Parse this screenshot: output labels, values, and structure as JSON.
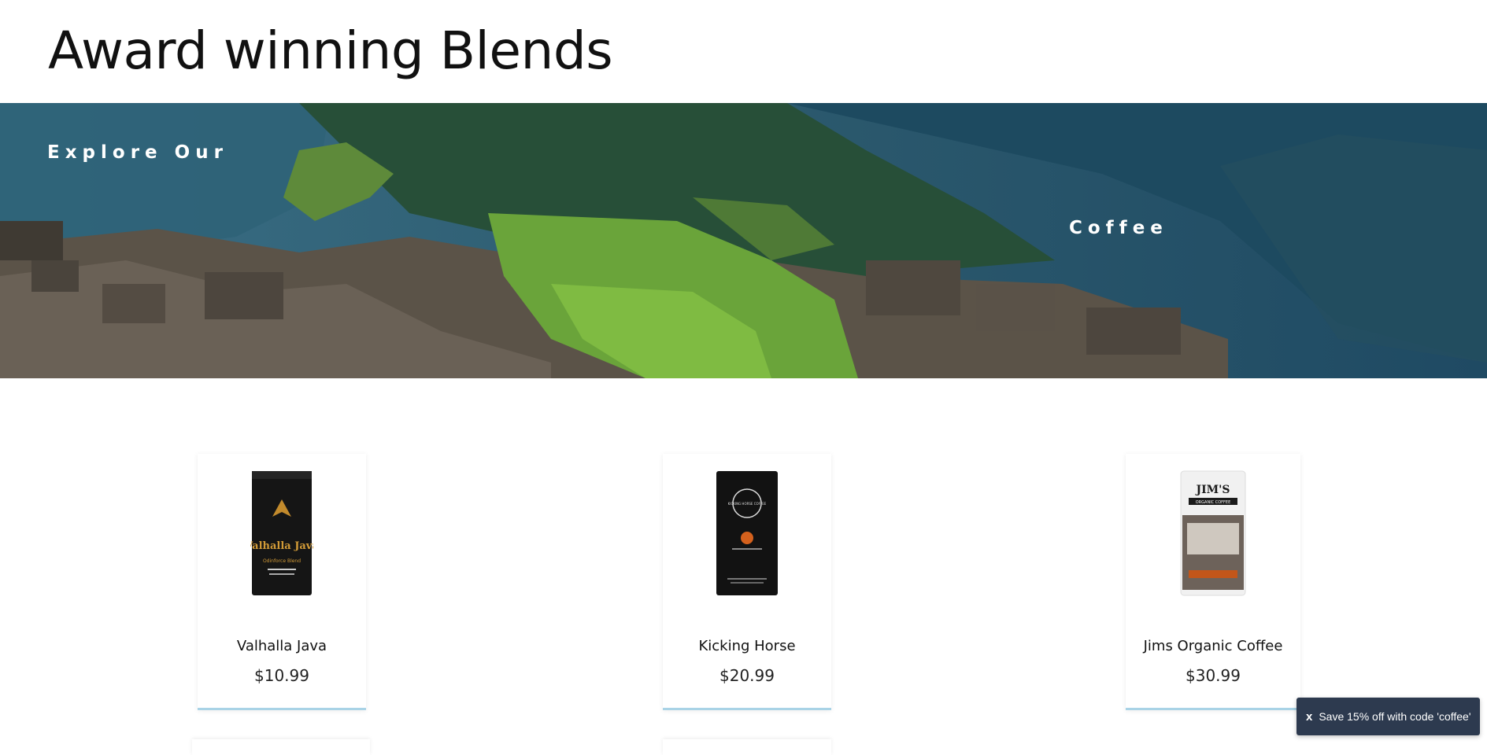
{
  "header": {
    "title": "Award winning Blends"
  },
  "hero": {
    "line1": "Explore Our",
    "line2": "Coffee"
  },
  "products": [
    {
      "name": "Valhalla Java",
      "price": "$10.99",
      "bag_brand": "Valhalla Java",
      "bag_sub": "Odinforce Blend"
    },
    {
      "name": "Kicking Horse",
      "price": "$20.99",
      "bag_brand": "KICKING HORSE COFFEE"
    },
    {
      "name": "Jims Organic Coffee",
      "price": "$30.99",
      "bag_brand": "JIM'S",
      "bag_sub": "ORGANIC COFFEE"
    }
  ],
  "promo": {
    "close_label": "x",
    "text": "Save 15% off with code 'coffee'"
  },
  "colors": {
    "promo_bg": "#2d3a4f",
    "card_accent": "#a9d3e6"
  }
}
